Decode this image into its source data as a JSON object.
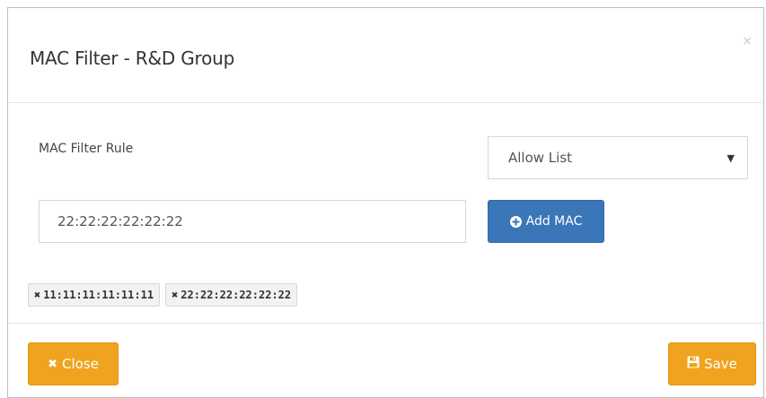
{
  "modal": {
    "title": "MAC Filter - R&D Group",
    "close_glyph": "×"
  },
  "rule": {
    "label": "MAC Filter Rule",
    "selected": "Allow List",
    "caret_icon": "caret-down-icon"
  },
  "input": {
    "value": "22:22:22:22:22:22"
  },
  "add_button": {
    "label": "Add MAC",
    "icon": "plus-circle-icon"
  },
  "tags": [
    {
      "label": "11:11:11:11:11:11",
      "icon": "remove-icon"
    },
    {
      "label": "22:22:22:22:22:22",
      "icon": "remove-icon"
    }
  ],
  "footer": {
    "close_label": "Close",
    "save_label": "Save"
  },
  "colors": {
    "primary": "#3a76b8",
    "warning": "#f0a31e"
  }
}
